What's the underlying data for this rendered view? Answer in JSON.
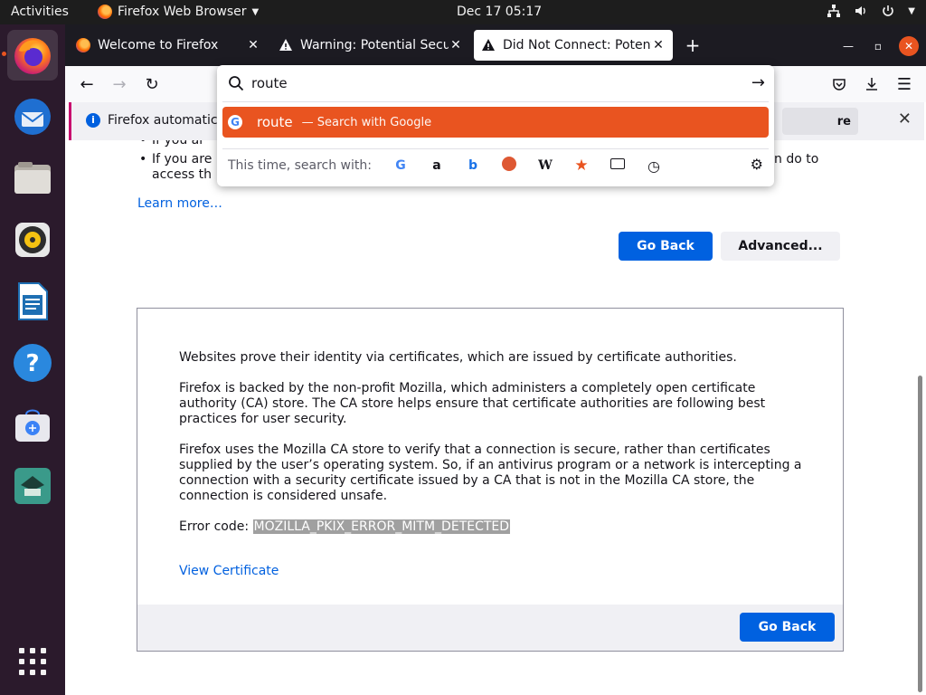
{
  "topbar": {
    "activities": "Activities",
    "app_name": "Firefox Web Browser",
    "clock": "Dec 17  05:17"
  },
  "tabs": [
    {
      "label": "Welcome to Firefox",
      "icon": "firefox-icon"
    },
    {
      "label": "Warning: Potential Securi",
      "icon": "warning-icon"
    },
    {
      "label": "Did Not Connect: Potenti",
      "icon": "warning-icon",
      "selected": true
    }
  ],
  "notification": {
    "text": "Firefox automatica",
    "button_suffix": "re"
  },
  "urlbar": {
    "value": "route",
    "suggestion_query": "route",
    "suggestion_hint": "— Search with Google",
    "engines_label": "This time, search with:"
  },
  "content": {
    "bullet_partial": "If you ar",
    "bullet_partial_2_left": "If you are",
    "bullet_partial_2_line2": "access th",
    "bullet_partial_2_right": "n do to",
    "learn_more": "Learn more…",
    "go_back": "Go Back",
    "advanced": "Advanced...",
    "p1": "Websites prove their identity via certificates, which are issued by certificate authorities.",
    "p2": "Firefox is backed by the non-profit Mozilla, which administers a completely open certificate authority (CA) store. The CA store helps ensure that certificate authorities are following best practices for user security.",
    "p3": "Firefox uses the Mozilla CA store to verify that a connection is secure, rather than certificates supplied by the user’s operating system. So, if an antivirus program or a network is intercepting a connection with a security certificate issued by a CA that is not in the Mozilla CA store, the connection is considered unsafe.",
    "error_label": "Error code: ",
    "error_code": "MOZILLA_PKIX_ERROR_MITM_DETECTED",
    "view_certificate": "View Certificate",
    "go_back_bottom": "Go Back"
  },
  "colors": {
    "accent": "#e95420",
    "primary_button": "#0061e0",
    "link": "#0060df"
  }
}
